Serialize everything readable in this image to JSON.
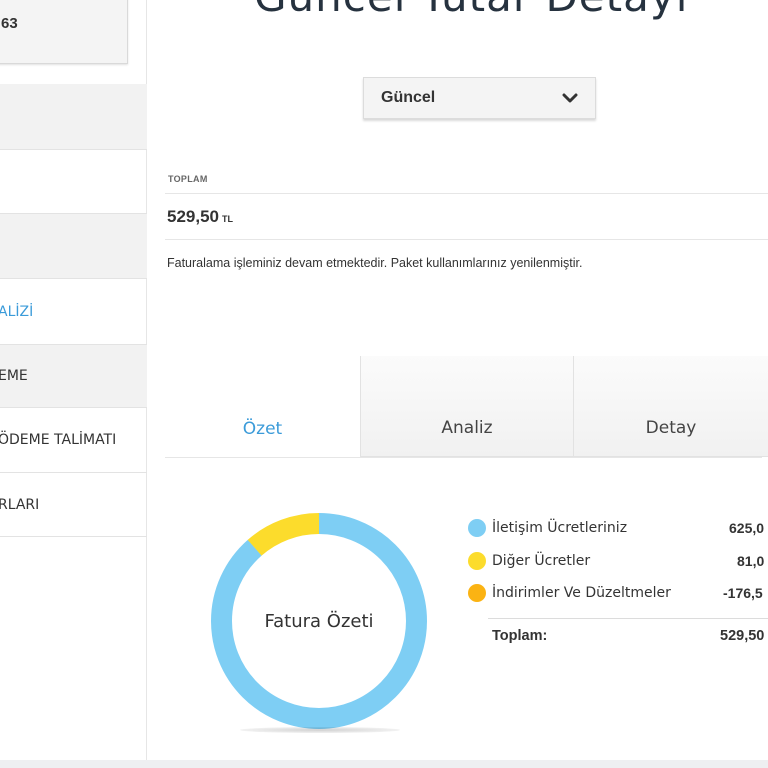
{
  "sidebar": {
    "card_number": "63",
    "items": [
      {
        "label": ""
      },
      {
        "label": ""
      },
      {
        "label": ""
      },
      {
        "label": "ALİZİ"
      },
      {
        "label": "EME"
      },
      {
        "label": "ÖDEME TALİMATI"
      },
      {
        "label": "RLARI"
      }
    ]
  },
  "header": {
    "title": "Güncel Tutar Detayı"
  },
  "period_select": {
    "value": "Güncel"
  },
  "total": {
    "label": "TOPLAM",
    "amount": "529,50",
    "currency": "TL",
    "message": "Faturalama işleminiz devam etmektedir. Paket kullanımlarınız yenilenmiştir."
  },
  "tabs": [
    {
      "label": "Özet",
      "active": true
    },
    {
      "label": "Analiz",
      "active": false
    },
    {
      "label": "Detay",
      "active": false
    }
  ],
  "summary": {
    "center_label": "Fatura Özeti",
    "legend": [
      {
        "label": "İletişim Ücretleriniz",
        "value": "625,0",
        "color": "#7ecef4"
      },
      {
        "label": "Diğer Ücretler",
        "value": "81,0",
        "color": "#fcdc2c"
      },
      {
        "label": "İndirimler Ve Düzeltmeler",
        "value": "-176,5",
        "color": "#fbb313"
      }
    ],
    "total_label": "Toplam:",
    "total_value": "529,50"
  },
  "chart_data": {
    "type": "pie",
    "categories": [
      "İletişim Ücretleriniz",
      "Diğer Ücretler"
    ],
    "values": [
      625.0,
      81.0
    ],
    "colors": [
      "#7ecef4",
      "#fcdc2c"
    ]
  }
}
